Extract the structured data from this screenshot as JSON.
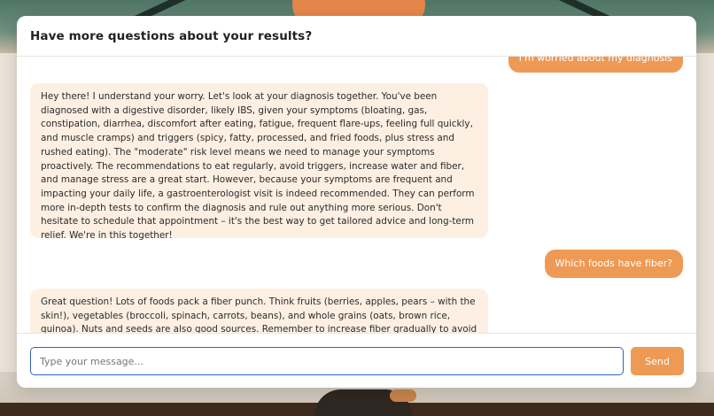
{
  "modal": {
    "title": "Have more questions about your results?"
  },
  "messages": [
    {
      "role": "user",
      "text": "I'm worried about my diagnosis"
    },
    {
      "role": "assistant",
      "text": "Hey there! I understand your worry. Let's look at your diagnosis together. You've been diagnosed with a digestive disorder, likely IBS, given your symptoms (bloating, gas, constipation, diarrhea, discomfort after eating, fatigue, frequent flare-ups, feeling full quickly, and muscle cramps) and triggers (spicy, fatty, processed, and fried foods, plus stress and rushed eating). The \"moderate\" risk level means we need to manage your symptoms proactively. The recommendations to eat regularly, avoid triggers, increase water and fiber, and manage stress are a great start. However, because your symptoms are frequent and impacting your daily life, a gastroenterologist visit is indeed recommended. They can perform more in-depth tests to confirm the diagnosis and rule out anything more serious. Don't hesitate to schedule that appointment – it's the best way to get tailored advice and long-term relief. We're in this together!"
    },
    {
      "role": "user",
      "text": "Which foods have fiber?"
    },
    {
      "role": "assistant",
      "text": "Great question! Lots of foods pack a fiber punch. Think fruits (berries, apples, pears – with the skin!), vegetables (broccoli, spinach, carrots, beans), and whole grains (oats, brown rice, quinoa). Nuts and seeds are also good sources. Remember to increase fiber gradually to avoid gas and bloating."
    }
  ],
  "composer": {
    "placeholder": "Type your message...",
    "value": "",
    "send_label": "Send"
  },
  "colors": {
    "accent": "#ee9a55",
    "assistant_bubble": "#fdf0e3",
    "input_focus": "#2f64b8"
  }
}
